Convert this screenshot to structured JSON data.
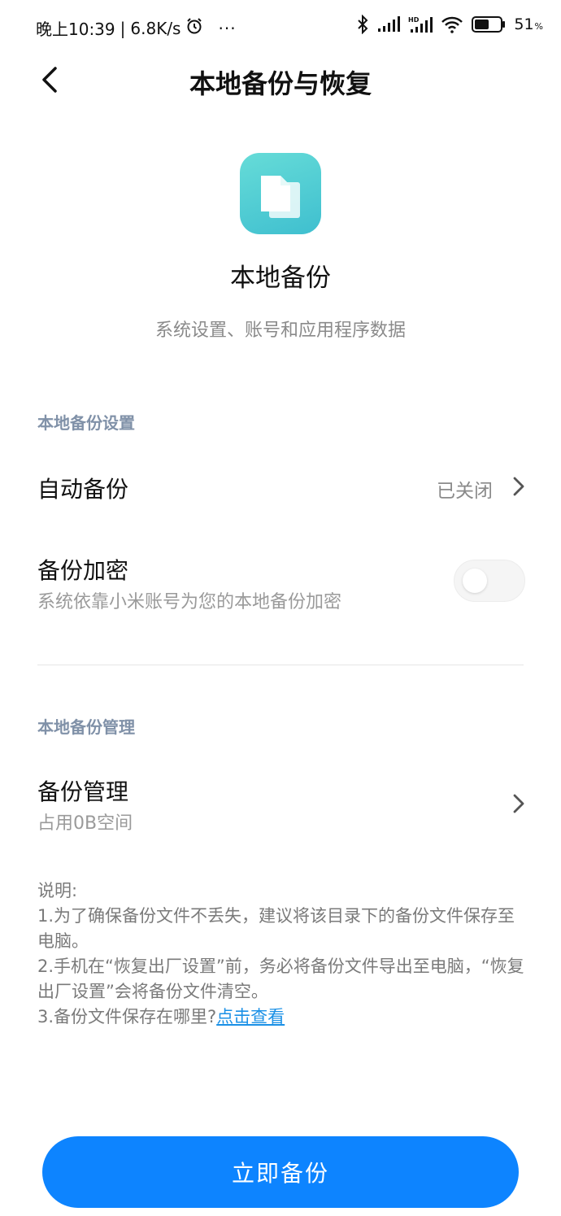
{
  "status": {
    "time": "晚上10:39",
    "network_speed": "6.8K/s",
    "more": "···",
    "battery_percent": "51",
    "battery_unit": "%"
  },
  "header": {
    "title": "本地备份与恢复",
    "back_icon": "chevron-left-icon"
  },
  "hero": {
    "icon": "document-copy-icon",
    "icon_colors": [
      "#66dcd8",
      "#3fbfcf"
    ],
    "title": "本地备份",
    "subtitle": "系统设置、账号和应用程序数据"
  },
  "settings_section": {
    "label": "本地备份设置",
    "auto_backup": {
      "title": "自动备份",
      "value": "已关闭"
    },
    "encryption": {
      "title": "备份加密",
      "description": "系统依靠小米账号为您的本地备份加密",
      "enabled": false
    }
  },
  "manage_section": {
    "label": "本地备份管理",
    "manage": {
      "title": "备份管理",
      "description": "占用0B空间"
    }
  },
  "notes": {
    "heading": "说明:",
    "line1": "1.为了确保备份文件不丢失，建议将该目录下的备份文件保存至电脑。",
    "line2": "2.手机在“恢复出厂设置”前，务必将备份文件导出至电脑，“恢复出厂设置”会将备份文件清空。",
    "line3_prefix": "3.备份文件保存在哪里?",
    "line3_link": "点击查看"
  },
  "primary_button": {
    "label": "立即备份",
    "color": "#0d84ff"
  }
}
